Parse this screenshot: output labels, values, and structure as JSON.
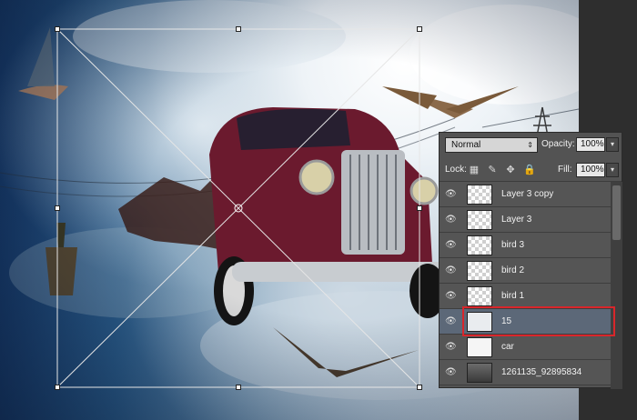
{
  "panel": {
    "blend_mode": "Normal",
    "opacity_label": "Opacity:",
    "opacity_value": "100%",
    "lock_label": "Lock:",
    "fill_label": "Fill:",
    "fill_value": "100%"
  },
  "layers": [
    {
      "name": "Layer 3 copy",
      "selected": false,
      "thumb": "transparent"
    },
    {
      "name": "Layer 3",
      "selected": false,
      "thumb": "transparent"
    },
    {
      "name": "bird 3",
      "selected": false,
      "thumb": "transparent"
    },
    {
      "name": "bird 2",
      "selected": false,
      "thumb": "transparent"
    },
    {
      "name": "bird 1",
      "selected": false,
      "thumb": "transparent"
    },
    {
      "name": "15",
      "selected": true,
      "thumb": "image"
    },
    {
      "name": "car",
      "selected": false,
      "thumb": "image"
    },
    {
      "name": "1261135_92895834",
      "selected": false,
      "thumb": "image"
    }
  ],
  "colors": {
    "selection_outline": "#d9262b",
    "panel_bg": "#535353",
    "selected_row": "#5c6878"
  },
  "icons": [
    "eye-icon",
    "lock-transparent-icon",
    "lock-brush-icon",
    "lock-move-icon",
    "lock-all-icon"
  ]
}
